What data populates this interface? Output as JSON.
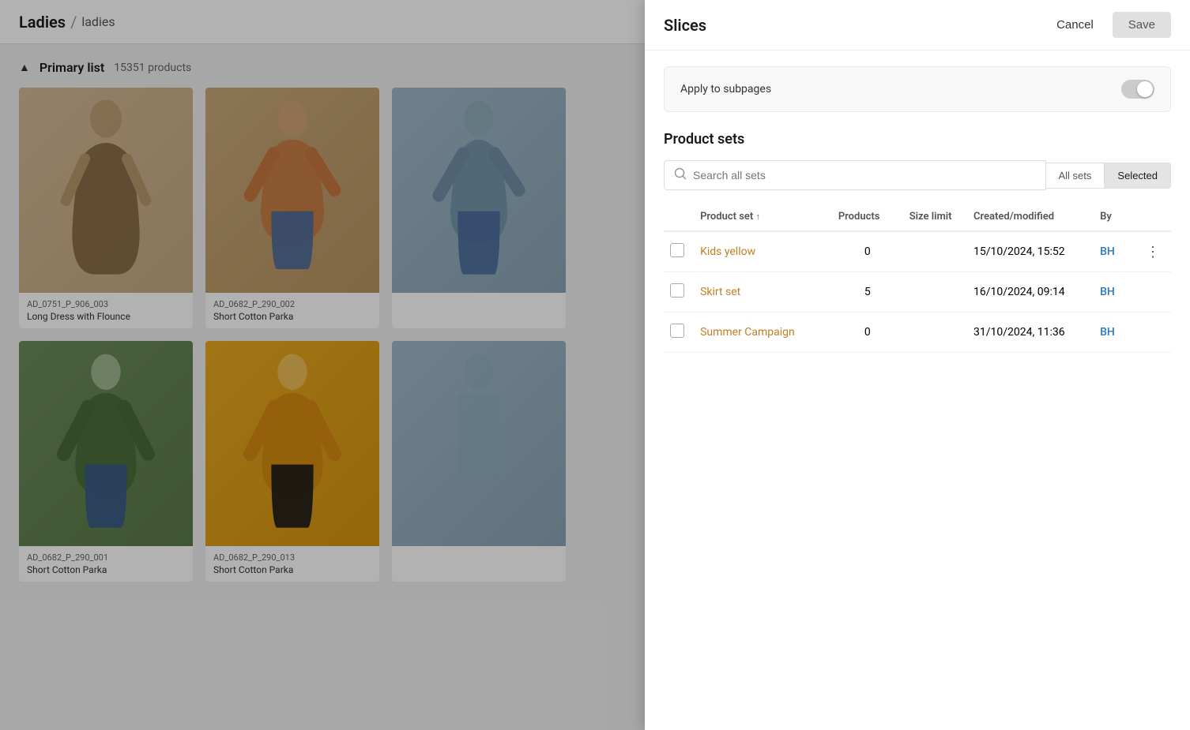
{
  "background": {
    "breadcrumb": {
      "root": "Ladies",
      "separator": "/",
      "sub": "ladies"
    },
    "primaryList": {
      "label": "Primary list",
      "count": "15351 products"
    },
    "products": [
      {
        "id": "prod-1",
        "code": "AD_0751_P_906_003",
        "name": "Long Dress with Flounce",
        "imgClass": "img-1"
      },
      {
        "id": "prod-2",
        "code": "AD_0682_P_290_002",
        "name": "Short Cotton Parka",
        "imgClass": "img-2"
      },
      {
        "id": "prod-3",
        "code": "",
        "name": "",
        "imgClass": "img-3"
      },
      {
        "id": "prod-4",
        "code": "AD_0682_P_290_001",
        "name": "Short Cotton Parka",
        "imgClass": "img-4"
      },
      {
        "id": "prod-5",
        "code": "AD_0682_P_290_013",
        "name": "Short Cotton Parka",
        "imgClass": "img-5"
      },
      {
        "id": "prod-6",
        "code": "",
        "name": "",
        "imgClass": "img-6"
      }
    ]
  },
  "panel": {
    "title": "Slices",
    "cancelLabel": "Cancel",
    "saveLabel": "Save",
    "applyToSubpages": "Apply to subpages",
    "productSetsTitle": "Product sets",
    "search": {
      "placeholder": "Search all sets"
    },
    "tabs": [
      {
        "id": "all",
        "label": "All sets",
        "active": true
      },
      {
        "id": "selected",
        "label": "Selected",
        "active": false
      }
    ],
    "table": {
      "columns": [
        {
          "id": "check",
          "label": ""
        },
        {
          "id": "name",
          "label": "Product set",
          "sortable": true,
          "sortDir": "asc"
        },
        {
          "id": "products",
          "label": "Products"
        },
        {
          "id": "size",
          "label": "Size limit"
        },
        {
          "id": "created",
          "label": "Created/modified"
        },
        {
          "id": "by",
          "label": "By"
        },
        {
          "id": "actions",
          "label": ""
        }
      ],
      "rows": [
        {
          "id": "row-1",
          "checked": false,
          "name": "Kids yellow",
          "products": "0",
          "sizeLimit": "",
          "createdModified": "15/10/2024, 15:52",
          "by": "BH",
          "hasMenu": true
        },
        {
          "id": "row-2",
          "checked": false,
          "name": "Skirt set",
          "products": "5",
          "sizeLimit": "",
          "createdModified": "16/10/2024, 09:14",
          "by": "BH",
          "hasMenu": false
        },
        {
          "id": "row-3",
          "checked": false,
          "name": "Summer Campaign",
          "products": "0",
          "sizeLimit": "",
          "createdModified": "31/10/2024, 11:36",
          "by": "BH",
          "hasMenu": false
        }
      ]
    }
  }
}
